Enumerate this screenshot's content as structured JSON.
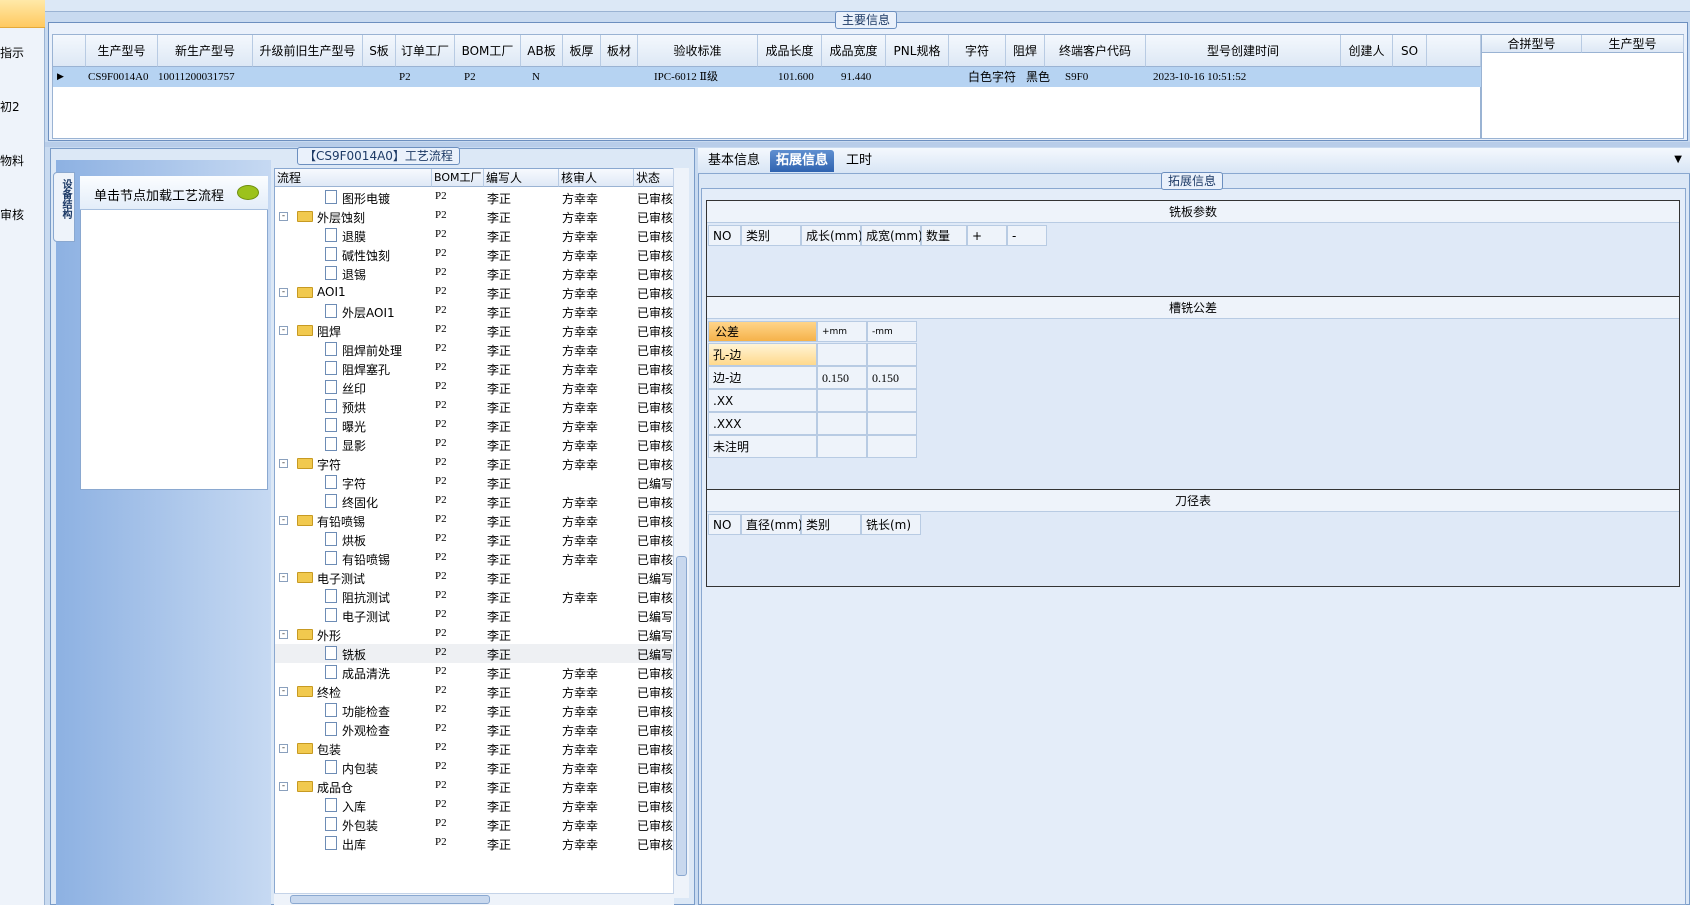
{
  "left_strip": {
    "items": [
      "指示",
      "初2",
      "物料",
      "审核"
    ]
  },
  "main_info": {
    "title": "主要信息",
    "columns": [
      "生产型号",
      "新生产型号",
      "升级前旧生产型号",
      "S板",
      "订单工厂",
      "BOM工厂",
      "AB板",
      "板厚",
      "板材",
      "验收标准",
      "成品长度",
      "成品宽度",
      "PNL规格",
      "字符",
      "阻焊",
      "终端客户代码",
      "型号创建时间",
      "创建人",
      "SO"
    ],
    "row": {
      "prod_model": "CS9F0014A0",
      "new_prod_model": "10011200031757",
      "order_factory": "P2",
      "bom_factory": "P2",
      "ab_board": "N",
      "standard": "IPC-6012 Ⅱ级",
      "length": "101.600",
      "width": "91.440",
      "char": "白色字符",
      "mask": "黑色",
      "customer": "S9F0",
      "created": "2023-10-16 10:51:52"
    },
    "side_columns": [
      "合拼型号",
      "生产型号"
    ]
  },
  "flow_panel": {
    "title": "【CS9F0014A0】工艺流程",
    "vtab": "设备结构",
    "node_hint": "单击节点加载工艺流程",
    "columns": [
      "流程",
      "BOM工厂",
      "编写人",
      "核审人",
      "状态"
    ],
    "rows": [
      {
        "name": "图形电镀",
        "level": 2,
        "bom": "P2",
        "writer": "李正",
        "reviewer": "方幸幸",
        "status": "已审核"
      },
      {
        "name": "外层蚀刻",
        "level": 1,
        "bom": "P2",
        "writer": "李正",
        "reviewer": "方幸幸",
        "status": "已审核"
      },
      {
        "name": "退膜",
        "level": 2,
        "bom": "P2",
        "writer": "李正",
        "reviewer": "方幸幸",
        "status": "已审核"
      },
      {
        "name": "碱性蚀刻",
        "level": 2,
        "bom": "P2",
        "writer": "李正",
        "reviewer": "方幸幸",
        "status": "已审核"
      },
      {
        "name": "退锡",
        "level": 2,
        "bom": "P2",
        "writer": "李正",
        "reviewer": "方幸幸",
        "status": "已审核"
      },
      {
        "name": "AOI1",
        "level": 1,
        "bom": "P2",
        "writer": "李正",
        "reviewer": "方幸幸",
        "status": "已审核"
      },
      {
        "name": "外层AOI1",
        "level": 2,
        "bom": "P2",
        "writer": "李正",
        "reviewer": "方幸幸",
        "status": "已审核"
      },
      {
        "name": "阻焊",
        "level": 1,
        "bom": "P2",
        "writer": "李正",
        "reviewer": "方幸幸",
        "status": "已审核"
      },
      {
        "name": "阻焊前处理",
        "level": 2,
        "bom": "P2",
        "writer": "李正",
        "reviewer": "方幸幸",
        "status": "已审核"
      },
      {
        "name": "阻焊塞孔",
        "level": 2,
        "bom": "P2",
        "writer": "李正",
        "reviewer": "方幸幸",
        "status": "已审核"
      },
      {
        "name": "丝印",
        "level": 2,
        "bom": "P2",
        "writer": "李正",
        "reviewer": "方幸幸",
        "status": "已审核"
      },
      {
        "name": "预烘",
        "level": 2,
        "bom": "P2",
        "writer": "李正",
        "reviewer": "方幸幸",
        "status": "已审核"
      },
      {
        "name": "曝光",
        "level": 2,
        "bom": "P2",
        "writer": "李正",
        "reviewer": "方幸幸",
        "status": "已审核"
      },
      {
        "name": "显影",
        "level": 2,
        "bom": "P2",
        "writer": "李正",
        "reviewer": "方幸幸",
        "status": "已审核"
      },
      {
        "name": "字符",
        "level": 1,
        "bom": "P2",
        "writer": "李正",
        "reviewer": "方幸幸",
        "status": "已审核"
      },
      {
        "name": "字符",
        "level": 2,
        "bom": "P2",
        "writer": "李正",
        "reviewer": "",
        "status": "已编写"
      },
      {
        "name": "终固化",
        "level": 2,
        "bom": "P2",
        "writer": "李正",
        "reviewer": "方幸幸",
        "status": "已审核"
      },
      {
        "name": "有铅喷锡",
        "level": 1,
        "bom": "P2",
        "writer": "李正",
        "reviewer": "方幸幸",
        "status": "已审核"
      },
      {
        "name": "烘板",
        "level": 2,
        "bom": "P2",
        "writer": "李正",
        "reviewer": "方幸幸",
        "status": "已审核"
      },
      {
        "name": "有铅喷锡",
        "level": 2,
        "bom": "P2",
        "writer": "李正",
        "reviewer": "方幸幸",
        "status": "已审核"
      },
      {
        "name": "电子测试",
        "level": 1,
        "bom": "P2",
        "writer": "李正",
        "reviewer": "",
        "status": "已编写"
      },
      {
        "name": "阻抗测试",
        "level": 2,
        "bom": "P2",
        "writer": "李正",
        "reviewer": "方幸幸",
        "status": "已审核"
      },
      {
        "name": "电子测试",
        "level": 2,
        "bom": "P2",
        "writer": "李正",
        "reviewer": "",
        "status": "已编写"
      },
      {
        "name": "外形",
        "level": 1,
        "bom": "P2",
        "writer": "李正",
        "reviewer": "",
        "status": "已编写"
      },
      {
        "name": "铣板",
        "level": 2,
        "bom": "P2",
        "writer": "李正",
        "reviewer": "",
        "status": "已编写",
        "selected": true
      },
      {
        "name": "成品清洗",
        "level": 2,
        "bom": "P2",
        "writer": "李正",
        "reviewer": "方幸幸",
        "status": "已审核"
      },
      {
        "name": "终检",
        "level": 1,
        "bom": "P2",
        "writer": "李正",
        "reviewer": "方幸幸",
        "status": "已审核"
      },
      {
        "name": "功能检查",
        "level": 2,
        "bom": "P2",
        "writer": "李正",
        "reviewer": "方幸幸",
        "status": "已审核"
      },
      {
        "name": "外观检查",
        "level": 2,
        "bom": "P2",
        "writer": "李正",
        "reviewer": "方幸幸",
        "status": "已审核"
      },
      {
        "name": "包装",
        "level": 1,
        "bom": "P2",
        "writer": "李正",
        "reviewer": "方幸幸",
        "status": "已审核"
      },
      {
        "name": "内包装",
        "level": 2,
        "bom": "P2",
        "writer": "李正",
        "reviewer": "方幸幸",
        "status": "已审核"
      },
      {
        "name": "成品仓",
        "level": 1,
        "bom": "P2",
        "writer": "李正",
        "reviewer": "方幸幸",
        "status": "已审核"
      },
      {
        "name": "入库",
        "level": 2,
        "bom": "P2",
        "writer": "李正",
        "reviewer": "方幸幸",
        "status": "已审核"
      },
      {
        "name": "外包装",
        "level": 2,
        "bom": "P2",
        "writer": "李正",
        "reviewer": "方幸幸",
        "status": "已审核"
      },
      {
        "name": "出库",
        "level": 2,
        "bom": "P2",
        "writer": "李正",
        "reviewer": "方幸幸",
        "status": "已审核"
      }
    ]
  },
  "detail": {
    "tabs": [
      "基本信息",
      "拓展信息",
      "工时"
    ],
    "active_tab": "拓展信息",
    "group_title": "拓展信息",
    "board_params": {
      "title": "铣板参数",
      "columns": [
        "NO",
        "类别",
        "成长(mm)",
        "成宽(mm)",
        "数量",
        "+",
        "-"
      ]
    },
    "tolerance": {
      "title": "槽铣公差",
      "columns": [
        "公差",
        "+mm",
        "-mm"
      ],
      "rows": [
        {
          "label": "孔-边",
          "plus": "",
          "minus": ""
        },
        {
          "label": "边-边",
          "plus": "0.150",
          "minus": "0.150"
        },
        {
          "label": ".XX",
          "plus": "",
          "minus": ""
        },
        {
          "label": ".XXX",
          "plus": "",
          "minus": ""
        },
        {
          "label": "未注明",
          "plus": "",
          "minus": ""
        }
      ]
    },
    "tool_table": {
      "title": "刀径表",
      "columns": [
        "NO",
        "直径(mm)",
        "类别",
        "铣长(m)"
      ]
    }
  }
}
